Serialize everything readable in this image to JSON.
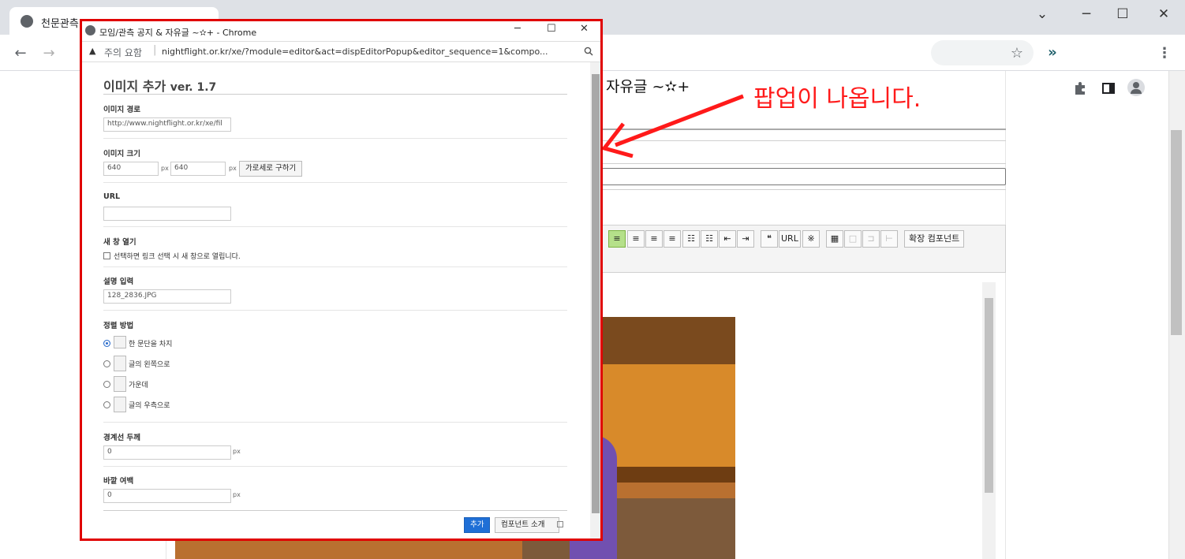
{
  "browser": {
    "tab_title": "천문관측",
    "window_controls": {
      "minimize": "─",
      "maximize": "☐",
      "close": "✕",
      "tab_list": "⌄"
    },
    "nav": {
      "back": "←",
      "forward": "→"
    },
    "toolbar_icons": [
      "share-icon",
      "bookmark-star-icon",
      "extension-dev-icon",
      "puzzle-extensions-icon",
      "side-panel-icon",
      "profile-avatar-icon",
      "menu-dots-icon"
    ]
  },
  "background_page": {
    "title": "자유글 ~✫+",
    "editor_buttons": [
      "❝",
      "URL",
      "※"
    ],
    "extend_component_button": "확장 컴포넌트"
  },
  "popup": {
    "window_title": "모임/관측 공지 & 자유글 ~✫+ - Chrome",
    "security_label": "주의 요함",
    "url": "nightflight.or.kr/xe/?module=editor&act=dispEditorPopup&editor_sequence=1&compo...",
    "heading": "이미지 추가",
    "version": "ver. 1.7",
    "image_path": {
      "label": "이미지 경로",
      "value": "http://www.nightflight.or.kr/xe/fil"
    },
    "image_size": {
      "label": "이미지 크기",
      "width": "640",
      "height": "640",
      "unit": "px",
      "calc_button": "가로세로 구하기"
    },
    "url_field": {
      "label": "URL",
      "value": ""
    },
    "new_window": {
      "label": "새 창 열기",
      "checkbox_text": "선택하면 링크 선택 시 새 창으로 열립니다.",
      "checked": false
    },
    "description": {
      "label": "설명 입력",
      "value": "128_2836.JPG"
    },
    "align": {
      "label": "정렬 방법",
      "selected": 0,
      "options": [
        "한 문단을 차지",
        "글의 왼쪽으로",
        "가운데",
        "글의 우측으로"
      ]
    },
    "border": {
      "label": "경계선 두께",
      "value": "0",
      "unit": "px"
    },
    "margin": {
      "label": "바깥 여백",
      "value": "0",
      "unit": "px"
    },
    "add_button": "추가",
    "about_button": "컴포넌트 소개"
  },
  "annotation": {
    "text": "팝업이 나옵니다.",
    "color": "#ff1a1a"
  },
  "colors": {
    "accent": "#1a73e8",
    "popup_border": "#e00000",
    "add_button_bg": "#1f6fd6"
  }
}
